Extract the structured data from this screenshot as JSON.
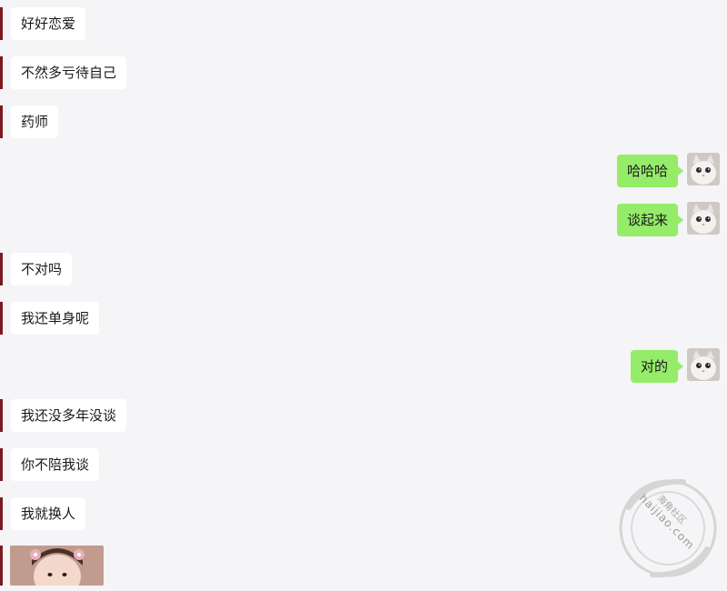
{
  "messages": [
    {
      "side": "left",
      "text": "好好恋爱"
    },
    {
      "side": "left",
      "text": "不然多亏待自己"
    },
    {
      "side": "left",
      "text": "药师"
    },
    {
      "side": "right",
      "text": "哈哈哈"
    },
    {
      "side": "right",
      "text": "谈起来"
    },
    {
      "side": "left",
      "text": "不对吗"
    },
    {
      "side": "left",
      "text": "我还单身呢"
    },
    {
      "side": "right",
      "text": "对的"
    },
    {
      "side": "left",
      "text": "我还没多年没谈"
    },
    {
      "side": "left",
      "text": "你不陪我谈"
    },
    {
      "side": "left",
      "text": "我就换人"
    }
  ],
  "watermark": {
    "site": "haijiao.com",
    "name": "海角社区"
  },
  "colors": {
    "background": "#f5f4f6",
    "incoming_bubble": "#ffffff",
    "outgoing_bubble": "#95ec69",
    "accent_bar": "#7a1a20"
  },
  "icons": {
    "outgoing_avatar": "cat-avatar-icon",
    "incoming_photo": "girl-photo-icon"
  }
}
